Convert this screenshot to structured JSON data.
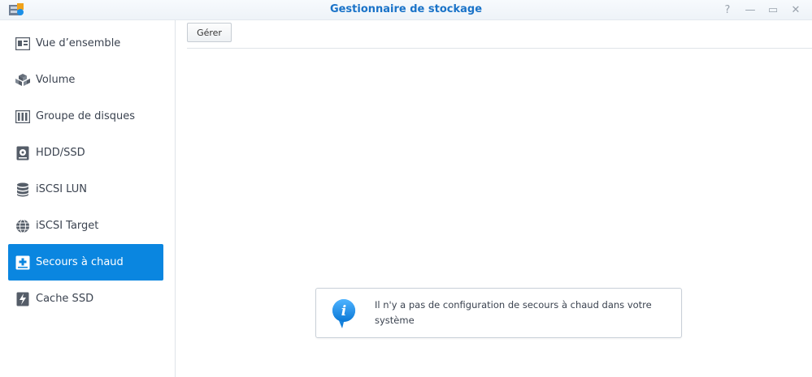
{
  "window": {
    "title": "Gestionnaire de stockage",
    "controls": [
      {
        "name": "help",
        "glyph": "?"
      },
      {
        "name": "minimize",
        "glyph": "—"
      },
      {
        "name": "maximize",
        "glyph": "▭"
      },
      {
        "name": "close",
        "glyph": "✕"
      }
    ]
  },
  "sidebar": {
    "items": [
      {
        "label": "Vue d’ensemble",
        "icon": "overview-icon"
      },
      {
        "label": "Volume",
        "icon": "volume-cubes-icon"
      },
      {
        "label": "Groupe de disques",
        "icon": "disk-group-icon"
      },
      {
        "label": "HDD/SSD",
        "icon": "hdd-icon"
      },
      {
        "label": "iSCSI LUN",
        "icon": "database-icon"
      },
      {
        "label": "iSCSI Target",
        "icon": "globe-icon"
      },
      {
        "label": "Secours à chaud",
        "icon": "hot-spare-icon",
        "active": true
      },
      {
        "label": "Cache SSD",
        "icon": "ssd-cache-icon"
      }
    ]
  },
  "toolbar": {
    "manage_label": "Gérer"
  },
  "notice": {
    "icon": "info-icon",
    "text": "Il n'y a pas de configuration de secours à chaud dans votre système"
  },
  "colors": {
    "accent": "#0a86e0",
    "title": "#1a73c8"
  }
}
